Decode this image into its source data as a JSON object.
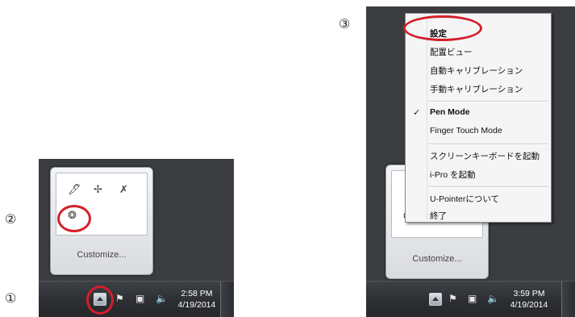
{
  "steps": {
    "one": "①",
    "two": "②",
    "three": "③"
  },
  "left_tray": {
    "customize": "Customize...",
    "clock_time": "2:58 PM",
    "clock_date": "4/19/2014"
  },
  "right_tray": {
    "customize": "Customize...",
    "clock_time": "3:59 PM",
    "clock_date": "4/19/2014"
  },
  "menu": {
    "items": [
      "設定",
      "配置ビュー",
      "自動キャリブレーション",
      "手動キャリブレーション",
      "Pen Mode",
      "Finger Touch Mode",
      "スクリーンキーボードを起動",
      "i-Pro を起動",
      "U-Pointerについて",
      "終了"
    ],
    "checked": "✓"
  },
  "colors": {
    "highlight_ring": "#d41f2a",
    "taskbar": "#2b2d31"
  },
  "icons": [
    "pen-tablet-icon",
    "network-icon",
    "disabled-device-icon",
    "u-pointer-icon",
    "flag-icon",
    "network-monitor-icon",
    "speaker-icon",
    "show-hidden-icons-arrow"
  ]
}
